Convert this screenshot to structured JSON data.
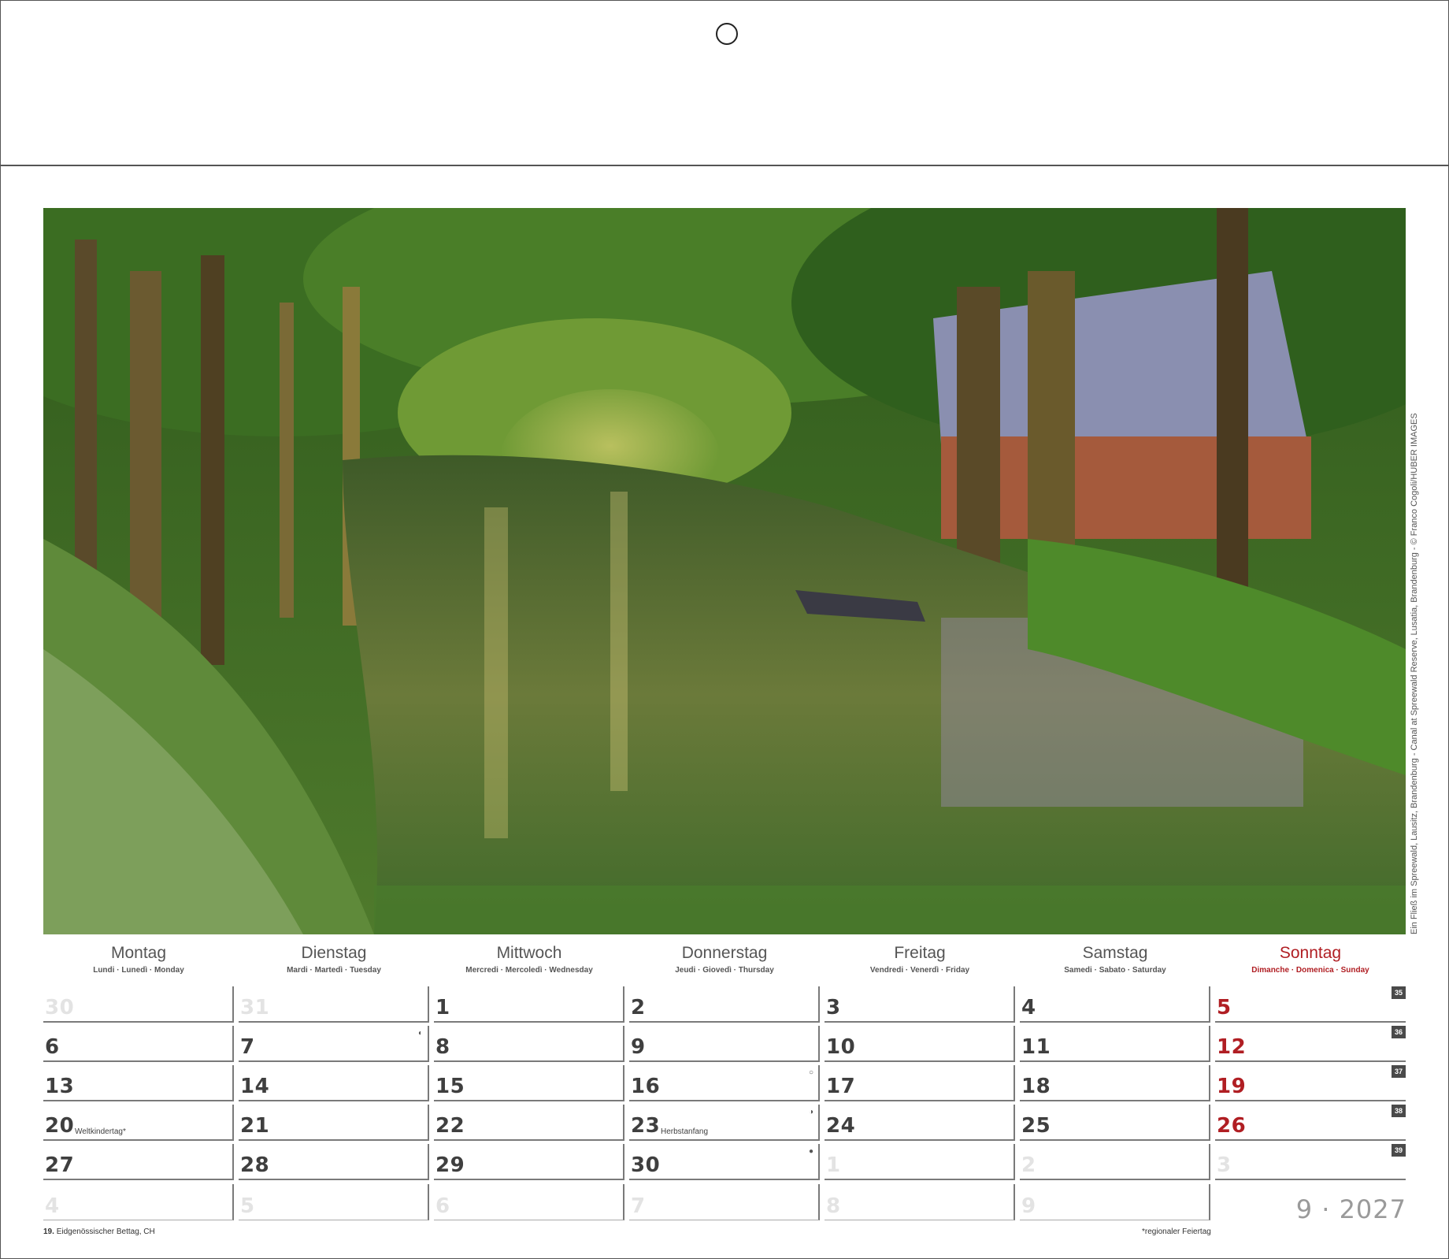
{
  "photo": {
    "credit": "Ein Fließ im Spreewald, Lausitz, Brandenburg - Canal at Spreewald Reserve, Lusatia, Brandenburg - © Franco Cogoli/HUBER IMAGES"
  },
  "colors": {
    "sunday": "#b01e23",
    "weekday": "#3f3f3f",
    "other_month": "#e3e3e3",
    "week_badge": "#4a4a4a"
  },
  "days": [
    {
      "name": "Montag",
      "sub": "Lundi · Lunedì · Monday"
    },
    {
      "name": "Dienstag",
      "sub": "Mardi · Martedì · Tuesday"
    },
    {
      "name": "Mittwoch",
      "sub": "Mercredi · Mercoledì · Wednesday"
    },
    {
      "name": "Donnerstag",
      "sub": "Jeudi · Giovedì · Thursday"
    },
    {
      "name": "Freitag",
      "sub": "Vendredi · Venerdì · Friday"
    },
    {
      "name": "Samstag",
      "sub": "Samedi · Sabato · Saturday"
    },
    {
      "name": "Sonntag",
      "sub": "Dimanche · Domenica · Sunday"
    }
  ],
  "weeks": [
    {
      "kw": "35",
      "cells": [
        {
          "n": "30",
          "other": true
        },
        {
          "n": "31",
          "other": true
        },
        {
          "n": "1"
        },
        {
          "n": "2"
        },
        {
          "n": "3"
        },
        {
          "n": "4"
        },
        {
          "n": "5",
          "sun": true
        }
      ]
    },
    {
      "kw": "36",
      "cells": [
        {
          "n": "6"
        },
        {
          "n": "7",
          "moon": "◐"
        },
        {
          "n": "8"
        },
        {
          "n": "9"
        },
        {
          "n": "10"
        },
        {
          "n": "11"
        },
        {
          "n": "12",
          "sun": true
        }
      ]
    },
    {
      "kw": "37",
      "cells": [
        {
          "n": "13"
        },
        {
          "n": "14"
        },
        {
          "n": "15"
        },
        {
          "n": "16",
          "moon": "○"
        },
        {
          "n": "17"
        },
        {
          "n": "18"
        },
        {
          "n": "19",
          "sun": true
        }
      ]
    },
    {
      "kw": "38",
      "cells": [
        {
          "n": "20",
          "note": "Weltkindertag*"
        },
        {
          "n": "21"
        },
        {
          "n": "22"
        },
        {
          "n": "23",
          "note": "Herbstanfang",
          "moon": "◑"
        },
        {
          "n": "24"
        },
        {
          "n": "25"
        },
        {
          "n": "26",
          "sun": true
        }
      ]
    },
    {
      "kw": "39",
      "cells": [
        {
          "n": "27"
        },
        {
          "n": "28"
        },
        {
          "n": "29"
        },
        {
          "n": "30",
          "moon": "●"
        },
        {
          "n": "1",
          "other": true
        },
        {
          "n": "2",
          "other": true
        },
        {
          "n": "3",
          "other": true
        }
      ]
    },
    {
      "kw": "",
      "cells": [
        {
          "n": "4",
          "other": true
        },
        {
          "n": "5",
          "other": true
        },
        {
          "n": "6",
          "other": true
        },
        {
          "n": "7",
          "other": true
        },
        {
          "n": "8",
          "other": true
        },
        {
          "n": "9",
          "other": true
        }
      ]
    }
  ],
  "footer": {
    "holiday_num": "19.",
    "holiday_text": "Eidgenössischer Bettag, CH",
    "regional": "*regionaler Feiertag"
  },
  "month_label": "9 · 2027"
}
